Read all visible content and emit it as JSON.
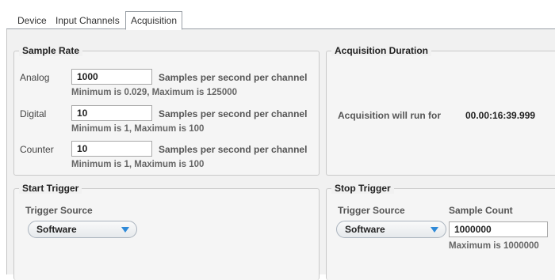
{
  "tabs": [
    {
      "label": "Device"
    },
    {
      "label": "Input Channels"
    },
    {
      "label": "Acquisition"
    }
  ],
  "sample_rate": {
    "title": "Sample Rate",
    "rows": [
      {
        "label": "Analog",
        "value": "1000",
        "unit": "Samples per second per channel",
        "hint": "Minimum is 0.029, Maximum is 125000"
      },
      {
        "label": "Digital",
        "value": "10",
        "unit": "Samples per second per channel",
        "hint": "Minimum is 1, Maximum is 100"
      },
      {
        "label": "Counter",
        "value": "10",
        "unit": "Samples per second per channel",
        "hint": "Minimum is 1, Maximum is 100"
      }
    ]
  },
  "acquisition_duration": {
    "title": "Acquisition Duration",
    "label": "Acquisition will run for",
    "value": "00.00:16:39.999"
  },
  "start_trigger": {
    "title": "Start Trigger",
    "source_label": "Trigger Source",
    "source_value": "Software"
  },
  "stop_trigger": {
    "title": "Stop Trigger",
    "source_label": "Trigger Source",
    "source_value": "Software",
    "count_label": "Sample Count",
    "count_value": "1000000",
    "count_hint": "Maximum is  1000000"
  },
  "colors": {
    "dropdown_arrow": "#2f8ad8",
    "panel_bg": "#f1f1f1"
  }
}
